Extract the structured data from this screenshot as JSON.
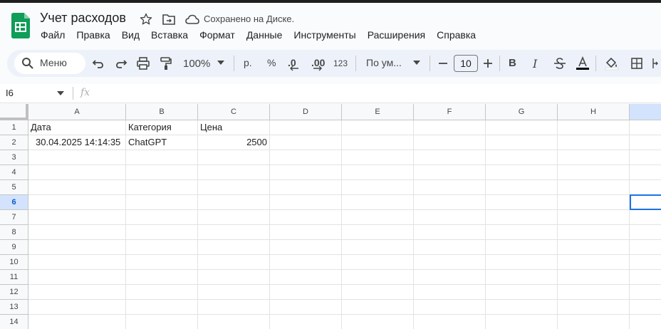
{
  "header": {
    "doc_title": "Учет расходов",
    "save_status": "Сохранено на Диске."
  },
  "menu": [
    "Файл",
    "Правка",
    "Вид",
    "Вставка",
    "Формат",
    "Данные",
    "Инструменты",
    "Расширения",
    "Справка"
  ],
  "toolbar": {
    "search_label": "Меню",
    "zoom": "100%",
    "currency": "р.",
    "percent": "%",
    "dec_decrease": ".0",
    "dec_increase": ".00",
    "number_format": "123",
    "font_name": "По ум...",
    "font_size": "10",
    "bold": "B",
    "italic": "I"
  },
  "formula_bar": {
    "name_box": "I6",
    "fx": "fx"
  },
  "sheet": {
    "columns": [
      "A",
      "B",
      "C",
      "D",
      "E",
      "F",
      "G",
      "H"
    ],
    "rows": [
      "1",
      "2",
      "3",
      "4",
      "5",
      "6",
      "7",
      "8",
      "9",
      "10",
      "11",
      "12",
      "13",
      "14"
    ],
    "selected_row": "6",
    "selected_cell": "I6",
    "cells": {
      "A1": "Дата",
      "B1": "Категория",
      "C1": "Цена",
      "A2": "30.04.2025 14:14:35",
      "B2": "ChatGPT",
      "C2": "2500"
    }
  },
  "colors": {
    "accent": "#1a73e8",
    "sheets_green": "#0f9d58",
    "toolbar_bg": "#edf2fa"
  }
}
